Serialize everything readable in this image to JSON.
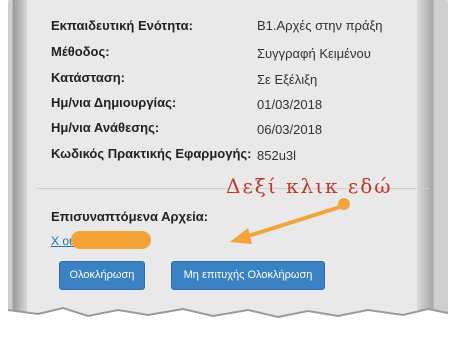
{
  "details": {
    "rows": [
      {
        "label": "Εκπαιδευτική Ενότητα:",
        "value": "Β1.Αρχές στην πράξη"
      },
      {
        "label": "Μέθοδος:",
        "value": "Συγγραφή Κειμένου"
      },
      {
        "label": "Κατάσταση:",
        "value": "Σε Εξέλιξη"
      },
      {
        "label": "Ημ/νια Δημιουργίας:",
        "value": "01/03/2018"
      },
      {
        "label": "Ημ/νια Ανάθεσης:",
        "value": "06/03/2018"
      },
      {
        "label": "Κωδικός Πρακτικής Εφαρμογής:",
        "value": "852u3l"
      }
    ]
  },
  "attachments": {
    "label": "Επισυναπτόμενα Αρχεία:",
    "file_link": "Χ                    ού Β1..docx"
  },
  "annotation": {
    "text": "Δεξί κλικ εδώ",
    "color": "#c0392b",
    "arrow_color": "#f2a33a"
  },
  "buttons": {
    "complete": "Ολοκλήρωση",
    "failed_complete": "Μη επιτυχής Ολοκλήρωση"
  }
}
